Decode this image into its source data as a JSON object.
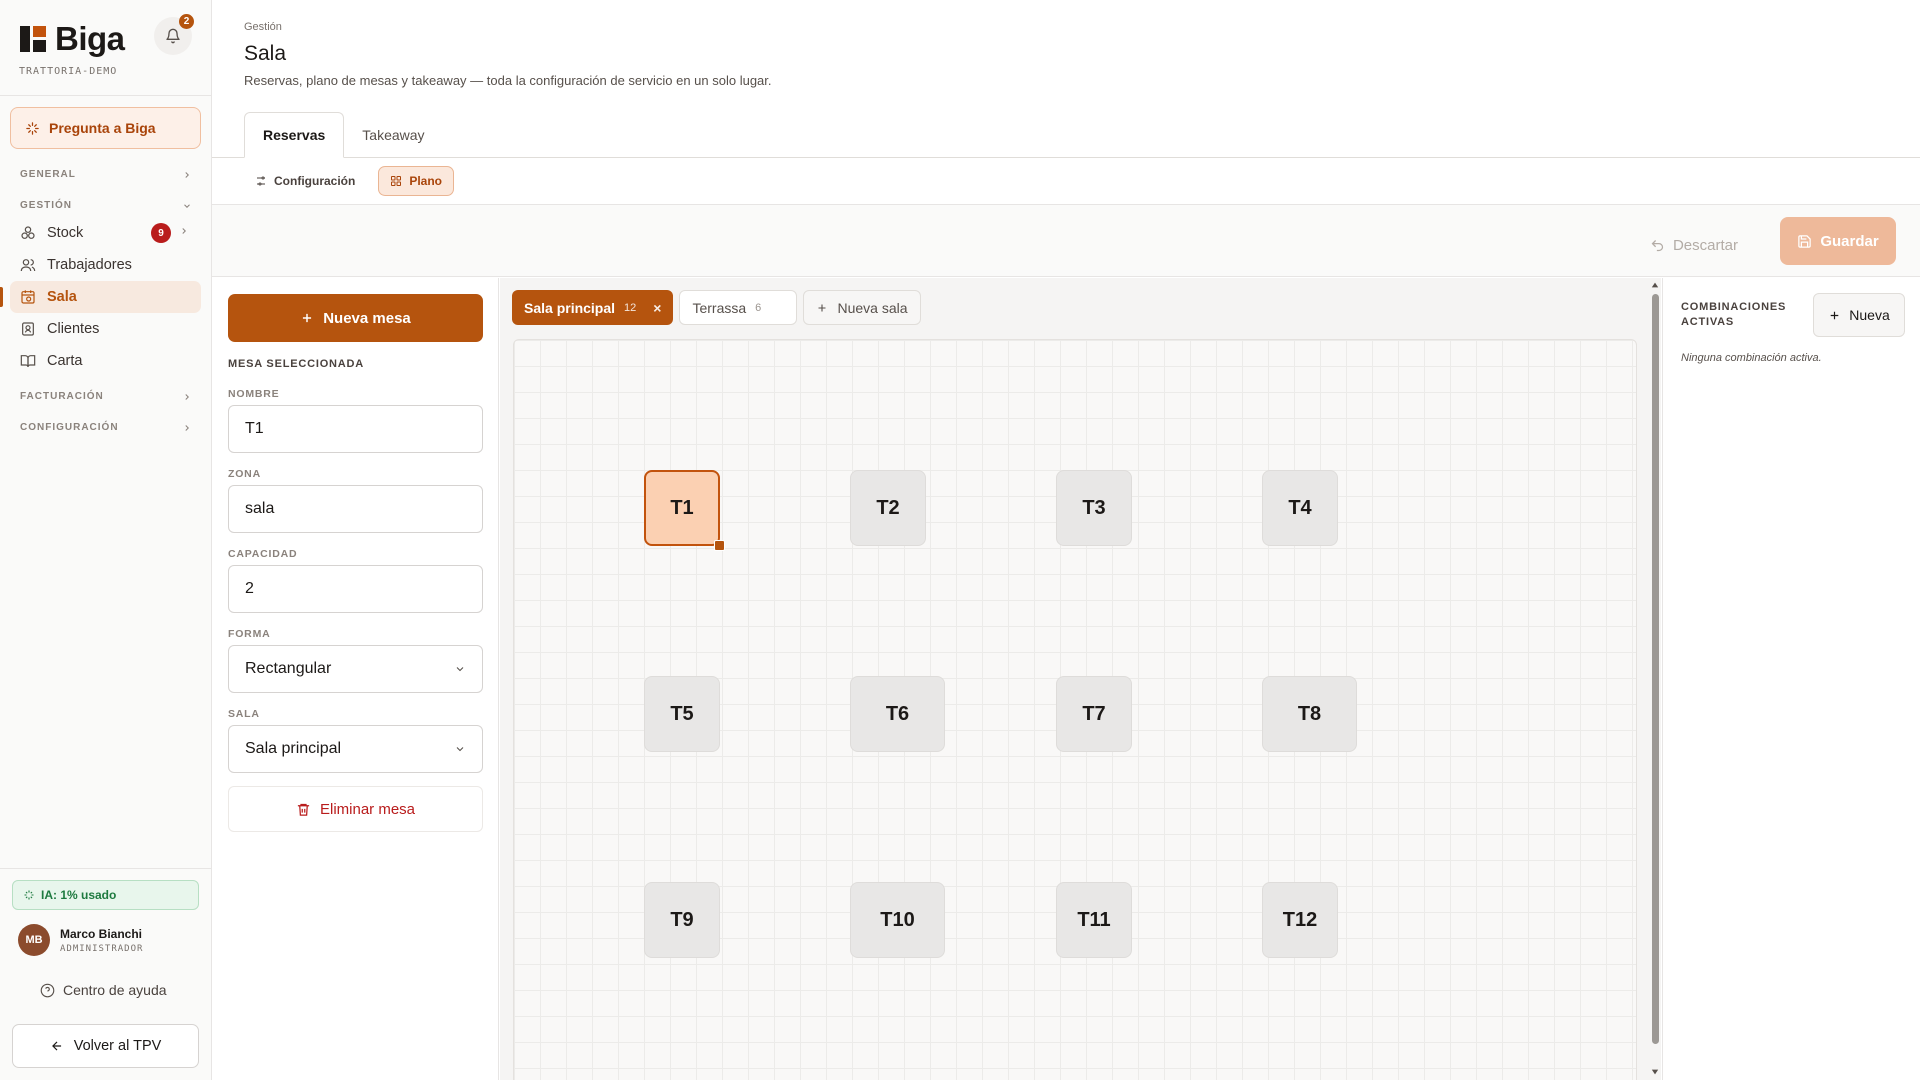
{
  "app": {
    "name": "Biga",
    "tenant": "TRATTORIA-DEMO",
    "notifications": "2"
  },
  "sidebar": {
    "ask_label": "Pregunta a Biga",
    "sections": {
      "general": "GENERAL",
      "gestion": "GESTIÓN",
      "facturacion": "FACTURACIÓN",
      "configuracion": "CONFIGURACIÓN"
    },
    "items": [
      {
        "label": "Stock",
        "badge": "9"
      },
      {
        "label": "Trabajadores"
      },
      {
        "label": "Sala"
      },
      {
        "label": "Clientes"
      },
      {
        "label": "Carta"
      }
    ],
    "ai_usage": "IA: 1% usado",
    "user": {
      "initials": "MB",
      "name": "Marco Bianchi",
      "role": "ADMINISTRADOR"
    },
    "help": "Centro de ayuda",
    "back": "Volver al TPV"
  },
  "header": {
    "breadcrumb": "Gestión",
    "title": "Sala",
    "description": "Reservas, plano de mesas y takeaway — toda la configuración de servicio en un solo lugar.",
    "tabs": [
      {
        "label": "Reservas"
      },
      {
        "label": "Takeaway"
      }
    ],
    "subtabs": [
      {
        "label": "Configuración"
      },
      {
        "label": "Plano"
      }
    ]
  },
  "toolbar": {
    "discard": "Descartar",
    "save": "Guardar"
  },
  "editor": {
    "new_table": "Nueva mesa",
    "section": "MESA SELECCIONADA",
    "name_label": "NOMBRE",
    "name_value": "T1",
    "zone_label": "ZONA",
    "zone_value": "sala",
    "capacity_label": "CAPACIDAD",
    "capacity_value": "2",
    "shape_label": "FORMA",
    "shape_value": "Rectangular",
    "room_label": "SALA",
    "room_value": "Sala principal",
    "delete": "Eliminar mesa"
  },
  "rooms": [
    {
      "name": "Sala principal",
      "count": "12"
    },
    {
      "name": "Terrassa",
      "count": "6"
    }
  ],
  "new_room": "Nueva sala",
  "tables": [
    "T1",
    "T2",
    "T3",
    "T4",
    "T5",
    "T6",
    "T7",
    "T8",
    "T9",
    "T10",
    "T11",
    "T12"
  ],
  "combinations": {
    "title": "COMBINACIONES ACTIVAS",
    "new": "Nueva",
    "empty": "Ninguna combinación activa."
  },
  "colors": {
    "accent": "#b5540e",
    "selected_fill": "#fbd0b2",
    "badge": "#b91c1c",
    "ai_green": "#1e7a3f"
  }
}
